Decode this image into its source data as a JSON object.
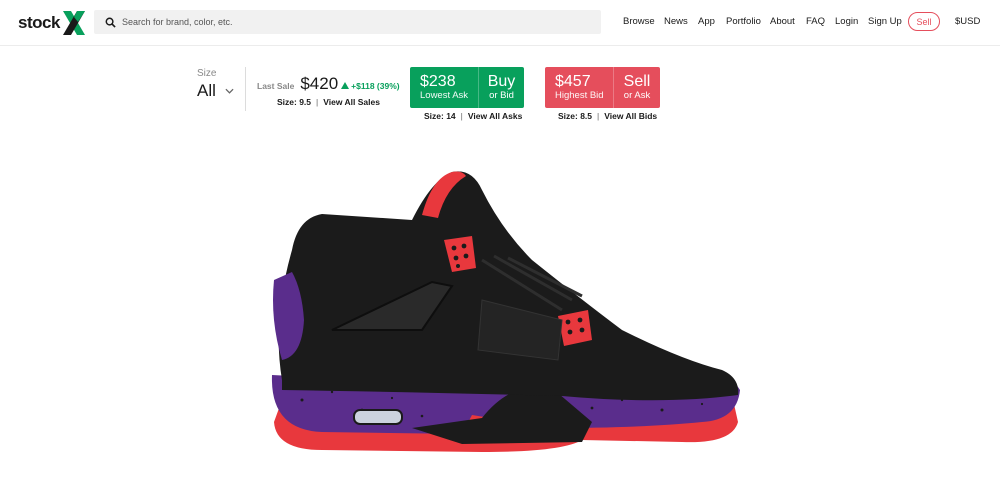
{
  "header": {
    "logo_text": "stock",
    "logo_x": "X",
    "search": {
      "placeholder": "Search for brand, color, etc."
    },
    "nav": [
      "Browse",
      "News",
      "App",
      "Portfolio",
      "About",
      "FAQ",
      "Login",
      "Sign Up"
    ],
    "sell_label": "Sell",
    "currency": "$USD"
  },
  "size": {
    "label": "Size",
    "value": "All"
  },
  "last_sale": {
    "label": "Last Sale",
    "price": "$420",
    "change": "+$118 (39%)",
    "size_text": "Size: 9.5",
    "link": "View All Sales"
  },
  "buy": {
    "price": "$238",
    "sub": "Lowest Ask",
    "action": "Buy",
    "or_text": "or Bid",
    "size_text": "Size: 14",
    "link": "View All Asks"
  },
  "sell": {
    "price": "$457",
    "sub": "Highest Bid",
    "action": "Sell",
    "or_text": "or Ask",
    "size_text": "Size: 8.5",
    "link": "View All Bids"
  },
  "colors": {
    "green": "#08a05c",
    "red": "#e54e5c",
    "shoe_black": "#1b1b1b",
    "shoe_red": "#e8383d",
    "shoe_purple": "#5a2d8c"
  },
  "icons": [
    "search-icon",
    "chevron-down-icon",
    "up-arrow-icon"
  ]
}
